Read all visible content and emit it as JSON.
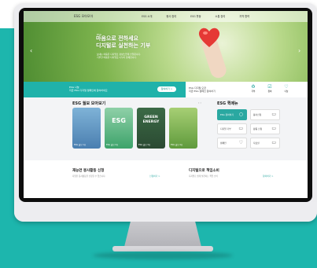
{
  "site": {
    "logo": "ESG 모아모아",
    "nav": [
      "ESG 소개",
      "봉사 참여",
      "ESG 활동",
      "소통 참여",
      "지역 협력"
    ]
  },
  "hero": {
    "small": "ESG",
    "title": "마음으로 전하세요\n디지털로 실천하는 기부",
    "desc": "보내는 마음은 디지털로 정성스럽게 전달됩니다.\n기부한 마음을 디지털로 나누어 함께합니다.",
    "prev": "‹",
    "next": "›"
  },
  "strip": {
    "text": "ESG 나눔\n지금 ESG 디지털 캠페인에 참여하세요",
    "button": "참여하기 >",
    "right_text": "ESG 디지털 모금\n지금 ESG 캠페인 참여하기",
    "icons": [
      {
        "glyph": "♻",
        "label": "기부"
      },
      {
        "glyph": "☑",
        "label": "참여"
      },
      {
        "glyph": "♡",
        "label": "나눔"
      }
    ]
  },
  "esg_section": {
    "title": "ESG 월보 모아보기",
    "arrows": "‹ ›",
    "cards": [
      {
        "big": "",
        "caption": "ESG 월보 1호"
      },
      {
        "big": "ESG",
        "caption": "ESG 월보 2호"
      },
      {
        "big": "GREEN ENERGY",
        "caption": "ESG 월보 3호"
      },
      {
        "big": "",
        "caption": "ESG 월보 4호"
      }
    ]
  },
  "menu_section": {
    "title": "ESG 퀵메뉴",
    "items": [
      {
        "label": "ESG 참여하기",
        "icon": "○"
      },
      {
        "label": "봉사신청",
        "icon": "▭"
      },
      {
        "label": "디지털 기부",
        "icon": "▭"
      },
      {
        "label": "활동 신청",
        "icon": "▭"
      },
      {
        "label": "캠페인",
        "icon": "♡"
      },
      {
        "label": "자료실",
        "icon": "▭"
      }
    ]
  },
  "bottom": {
    "left_title": "재능연 봉사활동 신청",
    "left_sub": "다양한 봉사활동을 신청할 수 있습니다.",
    "left_link": "신청하기 >",
    "right_title": "디지털으로 책임소비",
    "right_sub": "디지털로 쉽게 실천하는 책임 소비",
    "right_link": "참여하기 >"
  }
}
